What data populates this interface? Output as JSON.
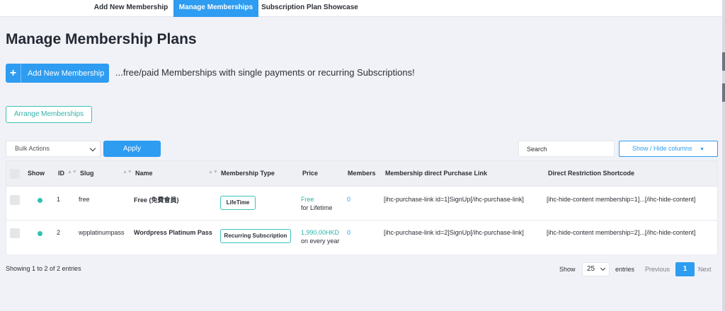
{
  "tabs": [
    {
      "label": "Add New Membership"
    },
    {
      "label": "Manage Memberships",
      "active": true
    },
    {
      "label": "Subscription Plan Showcase"
    }
  ],
  "page_title": "Manage Membership Plans",
  "add_button": {
    "icon": "plus-icon",
    "label": "Add New Membership"
  },
  "tagline": "...free/paid Memberships with single payments or recurring Subscriptions!",
  "arrange_button": "Arrange Memberships",
  "bulk_actions": {
    "selected": "Bulk Actions"
  },
  "apply_button": "Apply",
  "search": {
    "placeholder": "Search"
  },
  "show_hide_button": "Show / Hide columns",
  "show_hide_arrow": "▼",
  "table": {
    "headers": [
      "Show",
      "ID",
      "Slug",
      "Name",
      "Membership Type",
      "Price",
      "Members",
      "Membership direct Purchase Link",
      "Direct Restriction Shortcode"
    ],
    "rows": [
      {
        "id": "1",
        "slug": "free",
        "name": "Free (免費會員)",
        "type": "LifeTime",
        "price": "Free",
        "price_note": "for Lifetime",
        "members": "0",
        "purchase_link": "[ihc-purchase-link id=1]SignUp[/ihc-purchase-link]",
        "shortcode": "[ihc-hide-content membership=1]...[/ihc-hide-content]"
      },
      {
        "id": "2",
        "slug": "wpplatinumpass",
        "name": "Wordpress Platinum Pass",
        "type": "Recurring Subscription",
        "price": "1,990.00HKD",
        "price_note": "on every year",
        "members": "0",
        "purchase_link": "[ihc-purchase-link id=2]SignUp[/ihc-purchase-link]",
        "shortcode": "[ihc-hide-content membership=2]...[/ihc-hide-content]"
      }
    ]
  },
  "footer": {
    "info": "Showing 1 to 2 of 2 entries",
    "show_label": "Show",
    "page_size": "25",
    "entries_label": "entries",
    "previous": "Previous",
    "current_page": "1",
    "next": "Next"
  },
  "colors": {
    "accent": "#2d9cf1",
    "teal": "#2fb3a8",
    "background": "#f1f2f7"
  }
}
